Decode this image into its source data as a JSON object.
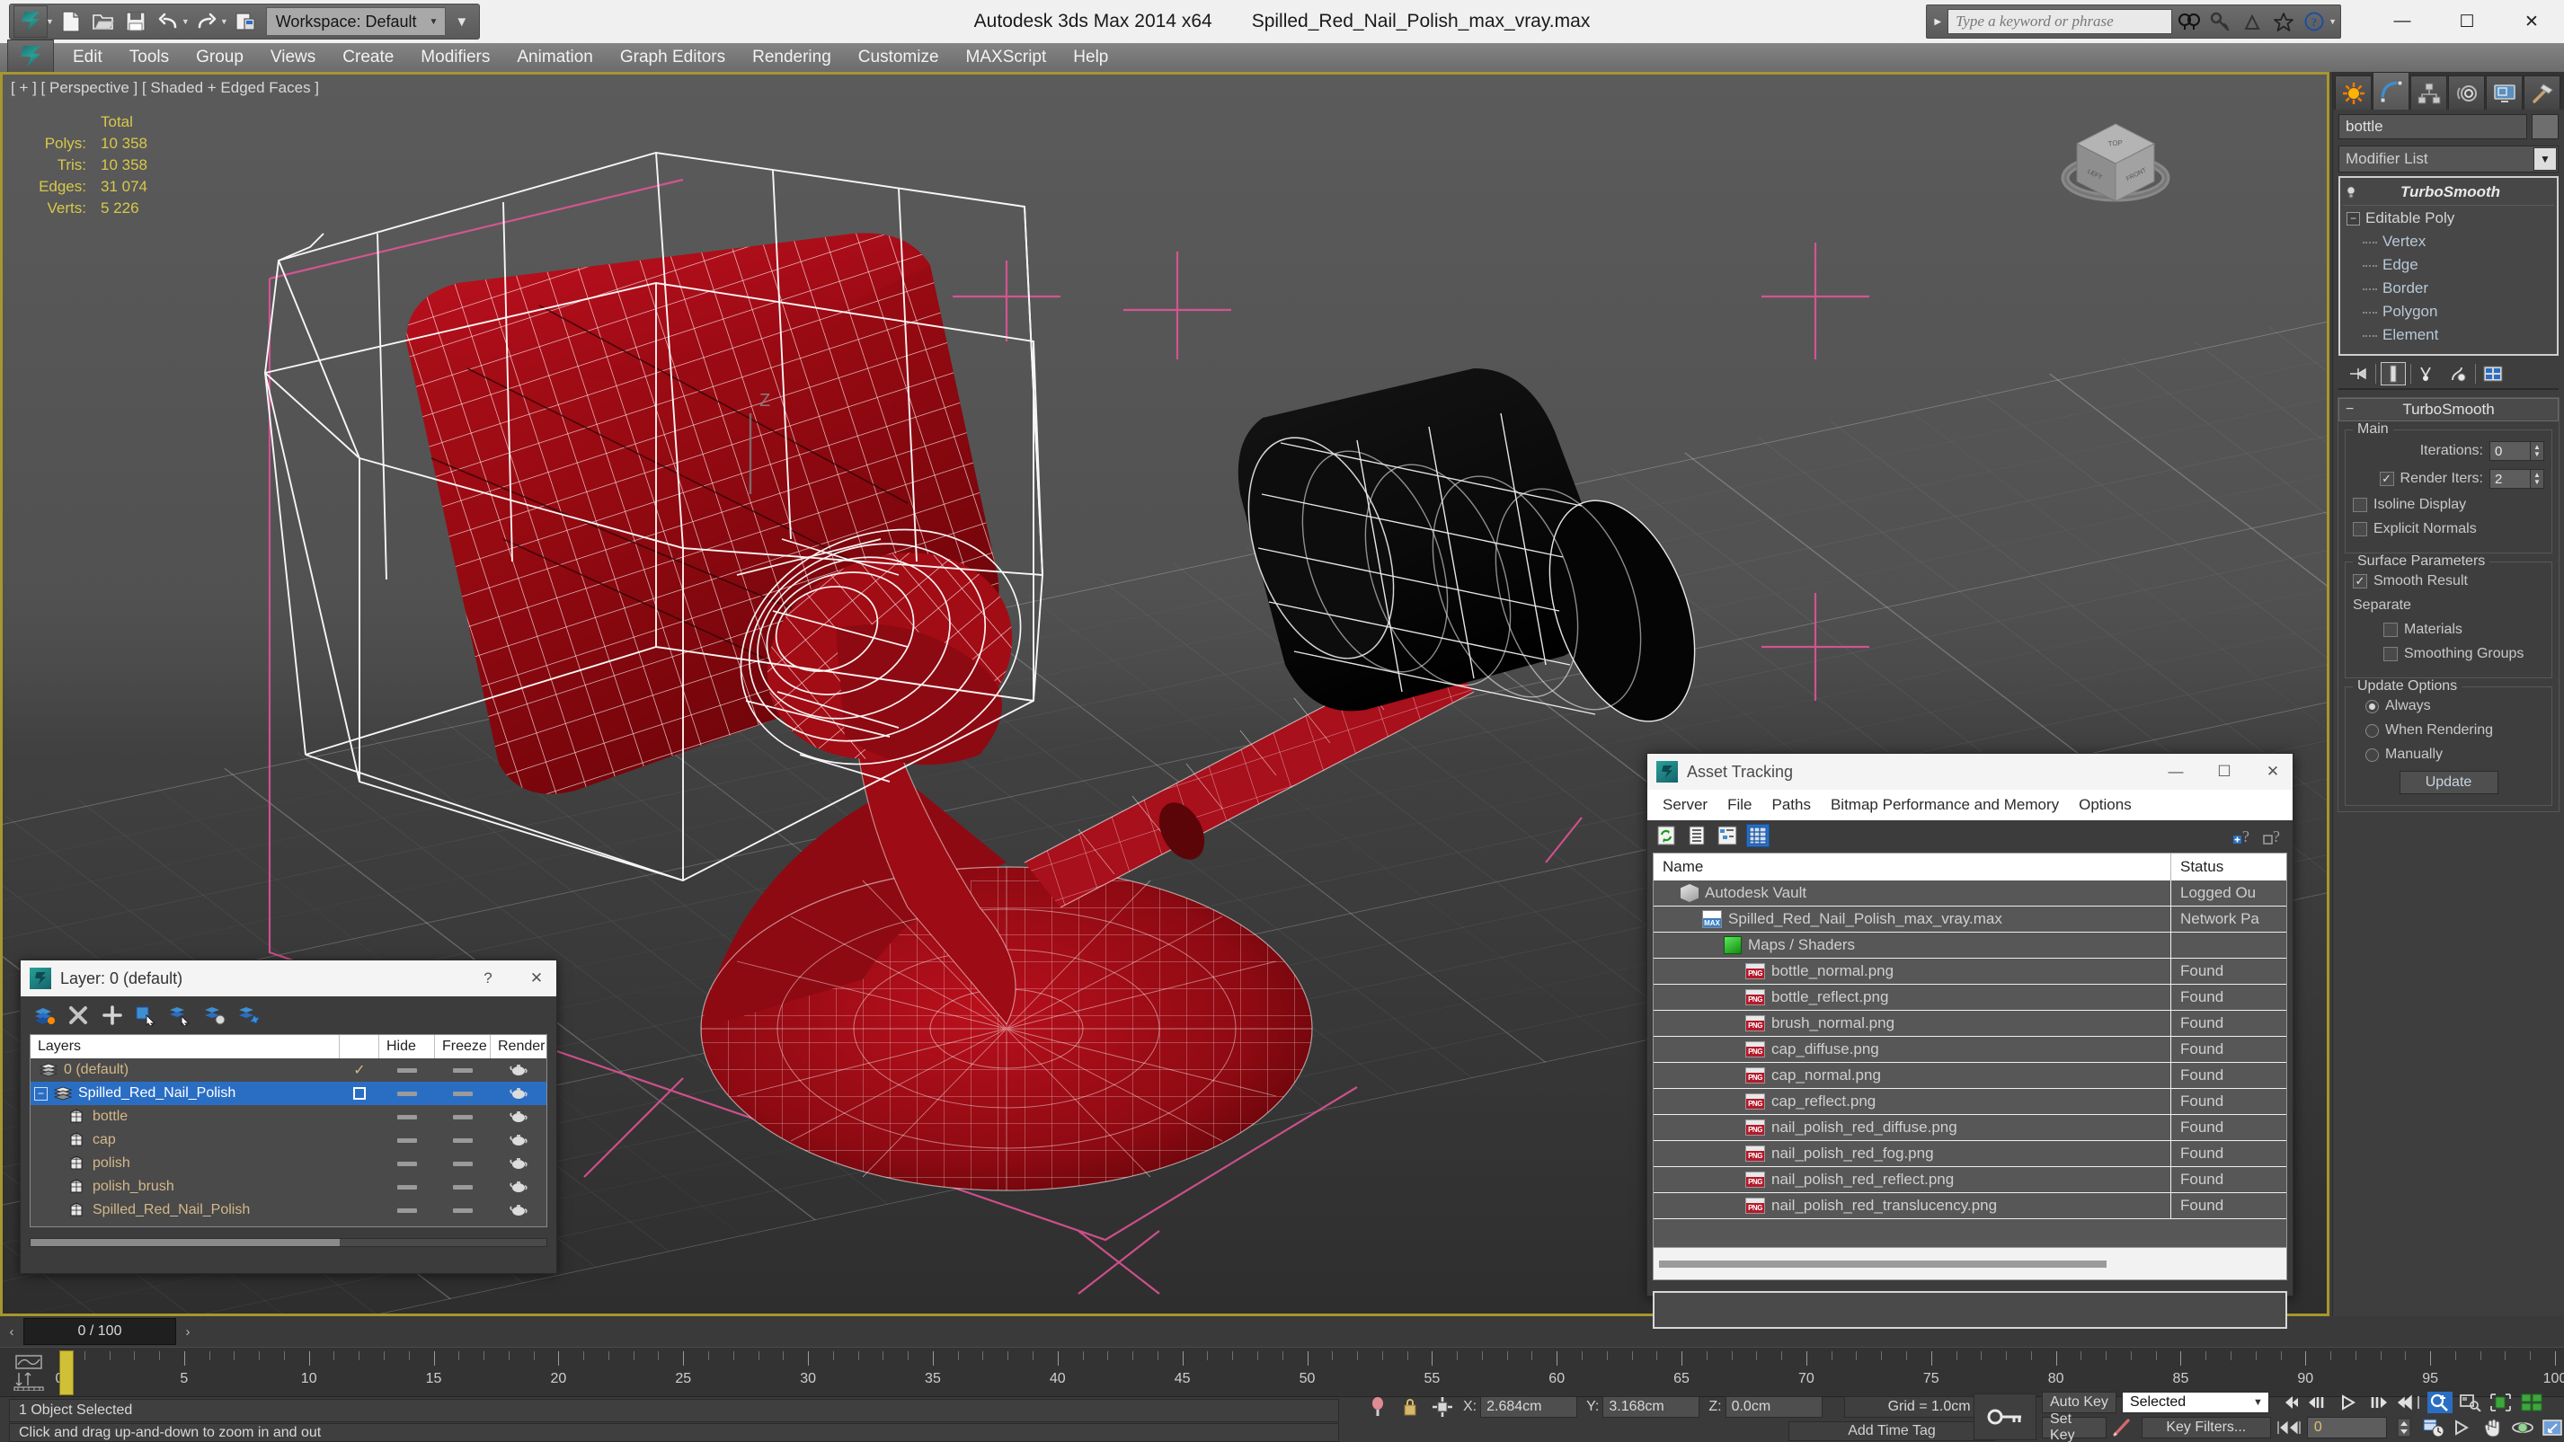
{
  "titlebar": {
    "app_title": "Autodesk 3ds Max  2014 x64",
    "file_title": "Spilled_Red_Nail_Polish_max_vray.max",
    "workspace_label": "Workspace: Default",
    "search_placeholder": "Type a keyword or phrase",
    "minimize": "—",
    "maximize": "☐",
    "close": "✕"
  },
  "menubar": {
    "items": [
      {
        "label": "Edit"
      },
      {
        "label": "Tools"
      },
      {
        "label": "Group"
      },
      {
        "label": "Views"
      },
      {
        "label": "Create"
      },
      {
        "label": "Modifiers"
      },
      {
        "label": "Animation"
      },
      {
        "label": "Graph Editors"
      },
      {
        "label": "Rendering"
      },
      {
        "label": "Customize"
      },
      {
        "label": "MAXScript"
      },
      {
        "label": "Help"
      }
    ]
  },
  "viewport": {
    "label": "[ + ] [ Perspective ] [ Shaded + Edged Faces ]",
    "stats": {
      "header": "Total",
      "rows": [
        {
          "label": "Polys:",
          "value": "10 358"
        },
        {
          "label": "Tris:",
          "value": "10 358"
        },
        {
          "label": "Edges:",
          "value": "31 074"
        },
        {
          "label": "Verts:",
          "value": "5 226"
        }
      ]
    }
  },
  "command_panel": {
    "object_name": "bottle",
    "modifier_list_label": "Modifier List",
    "stack": [
      {
        "label": "TurboSmooth",
        "type": "modifier"
      },
      {
        "label": "Editable Poly",
        "type": "base"
      },
      {
        "label": "Vertex",
        "type": "sub"
      },
      {
        "label": "Edge",
        "type": "sub"
      },
      {
        "label": "Border",
        "type": "sub"
      },
      {
        "label": "Polygon",
        "type": "sub"
      },
      {
        "label": "Element",
        "type": "sub"
      }
    ],
    "rollout": {
      "title": "TurboSmooth",
      "main_group": "Main",
      "iterations_label": "Iterations:",
      "iterations_value": "0",
      "render_iters_label": "Render Iters:",
      "render_iters_value": "2",
      "render_iters_checked": true,
      "isoline_label": "Isoline Display",
      "isoline_checked": false,
      "explicit_label": "Explicit Normals",
      "explicit_checked": false,
      "surface_group": "Surface Parameters",
      "smooth_result_label": "Smooth Result",
      "smooth_result_checked": true,
      "separate_label": "Separate",
      "materials_label": "Materials",
      "materials_checked": false,
      "smoothing_groups_label": "Smoothing Groups",
      "smoothing_groups_checked": false,
      "update_group": "Update Options",
      "update_options": [
        {
          "label": "Always",
          "selected": true
        },
        {
          "label": "When Rendering",
          "selected": false
        },
        {
          "label": "Manually",
          "selected": false
        }
      ],
      "update_button": "Update"
    }
  },
  "layer_dialog": {
    "title": "Layer: 0 (default)",
    "help_label": "?",
    "close_label": "✕",
    "columns": [
      "Layers",
      "",
      "Hide",
      "Freeze",
      "Render"
    ],
    "rows": [
      {
        "name": "0 (default)",
        "indent": 0,
        "icon": "layer-icon",
        "active": true,
        "selected": false,
        "expandable": false
      },
      {
        "name": "Spilled_Red_Nail_Polish",
        "indent": 0,
        "icon": "layer-icon",
        "active": false,
        "selected": true,
        "expandable": true
      },
      {
        "name": "bottle",
        "indent": 1,
        "icon": "object-icon",
        "active": false,
        "selected": false,
        "expandable": false
      },
      {
        "name": "cap",
        "indent": 1,
        "icon": "object-icon",
        "active": false,
        "selected": false,
        "expandable": false
      },
      {
        "name": "polish",
        "indent": 1,
        "icon": "object-icon",
        "active": false,
        "selected": false,
        "expandable": false
      },
      {
        "name": "polish_brush",
        "indent": 1,
        "icon": "object-icon",
        "active": false,
        "selected": false,
        "expandable": false
      },
      {
        "name": "Spilled_Red_Nail_Polish",
        "indent": 1,
        "icon": "object-icon",
        "active": false,
        "selected": false,
        "expandable": false
      }
    ]
  },
  "asset_dialog": {
    "title": "Asset Tracking",
    "minimize": "—",
    "maximize": "☐",
    "close": "✕",
    "menu": [
      "Server",
      "File",
      "Paths",
      "Bitmap Performance and Memory",
      "Options"
    ],
    "columns": {
      "name": "Name",
      "status": "Status"
    },
    "rows": [
      {
        "name": "Autodesk Vault",
        "status": "Logged Ou",
        "indent": 0,
        "icon": "vault-icon"
      },
      {
        "name": "Spilled_Red_Nail_Polish_max_vray.max",
        "status": "Network Pa",
        "indent": 1,
        "icon": "max-icon"
      },
      {
        "name": "Maps / Shaders",
        "status": "",
        "indent": 2,
        "icon": "maps-icon"
      },
      {
        "name": "bottle_normal.png",
        "status": "Found",
        "indent": 3,
        "icon": "png-icon"
      },
      {
        "name": "bottle_reflect.png",
        "status": "Found",
        "indent": 3,
        "icon": "png-icon"
      },
      {
        "name": "brush_normal.png",
        "status": "Found",
        "indent": 3,
        "icon": "png-icon"
      },
      {
        "name": "cap_diffuse.png",
        "status": "Found",
        "indent": 3,
        "icon": "png-icon"
      },
      {
        "name": "cap_normal.png",
        "status": "Found",
        "indent": 3,
        "icon": "png-icon"
      },
      {
        "name": "cap_reflect.png",
        "status": "Found",
        "indent": 3,
        "icon": "png-icon"
      },
      {
        "name": "nail_polish_red_diffuse.png",
        "status": "Found",
        "indent": 3,
        "icon": "png-icon"
      },
      {
        "name": "nail_polish_red_fog.png",
        "status": "Found",
        "indent": 3,
        "icon": "png-icon"
      },
      {
        "name": "nail_polish_red_reflect.png",
        "status": "Found",
        "indent": 3,
        "icon": "png-icon"
      },
      {
        "name": "nail_polish_red_translucency.png",
        "status": "Found",
        "indent": 3,
        "icon": "png-icon"
      }
    ]
  },
  "timeline": {
    "frame_display": "0 / 100",
    "prev_label": "‹",
    "next_label": "›",
    "current_frame": "0",
    "ticks": [
      0,
      5,
      10,
      15,
      20,
      25,
      30,
      35,
      40,
      45,
      50,
      55,
      60,
      65,
      70,
      75,
      80,
      85,
      90,
      95,
      100
    ],
    "range_start": 0,
    "range_end": 100
  },
  "statusbar": {
    "selection_text": "1 Object Selected",
    "prompt_text": "Click and drag up-and-down to zoom in and out",
    "x_label": "X:",
    "x_value": "2.684cm",
    "y_label": "Y:",
    "y_value": "3.168cm",
    "z_label": "Z:",
    "z_value": "0.0cm",
    "grid_text": "Grid = 1.0cm",
    "add_time_tag": "Add Time Tag"
  },
  "anim_controls": {
    "auto_key": "Auto Key",
    "set_key": "Set Key",
    "selection_level": "Selected",
    "key_filters": "Key Filters...",
    "frame_spinner": "0"
  }
}
